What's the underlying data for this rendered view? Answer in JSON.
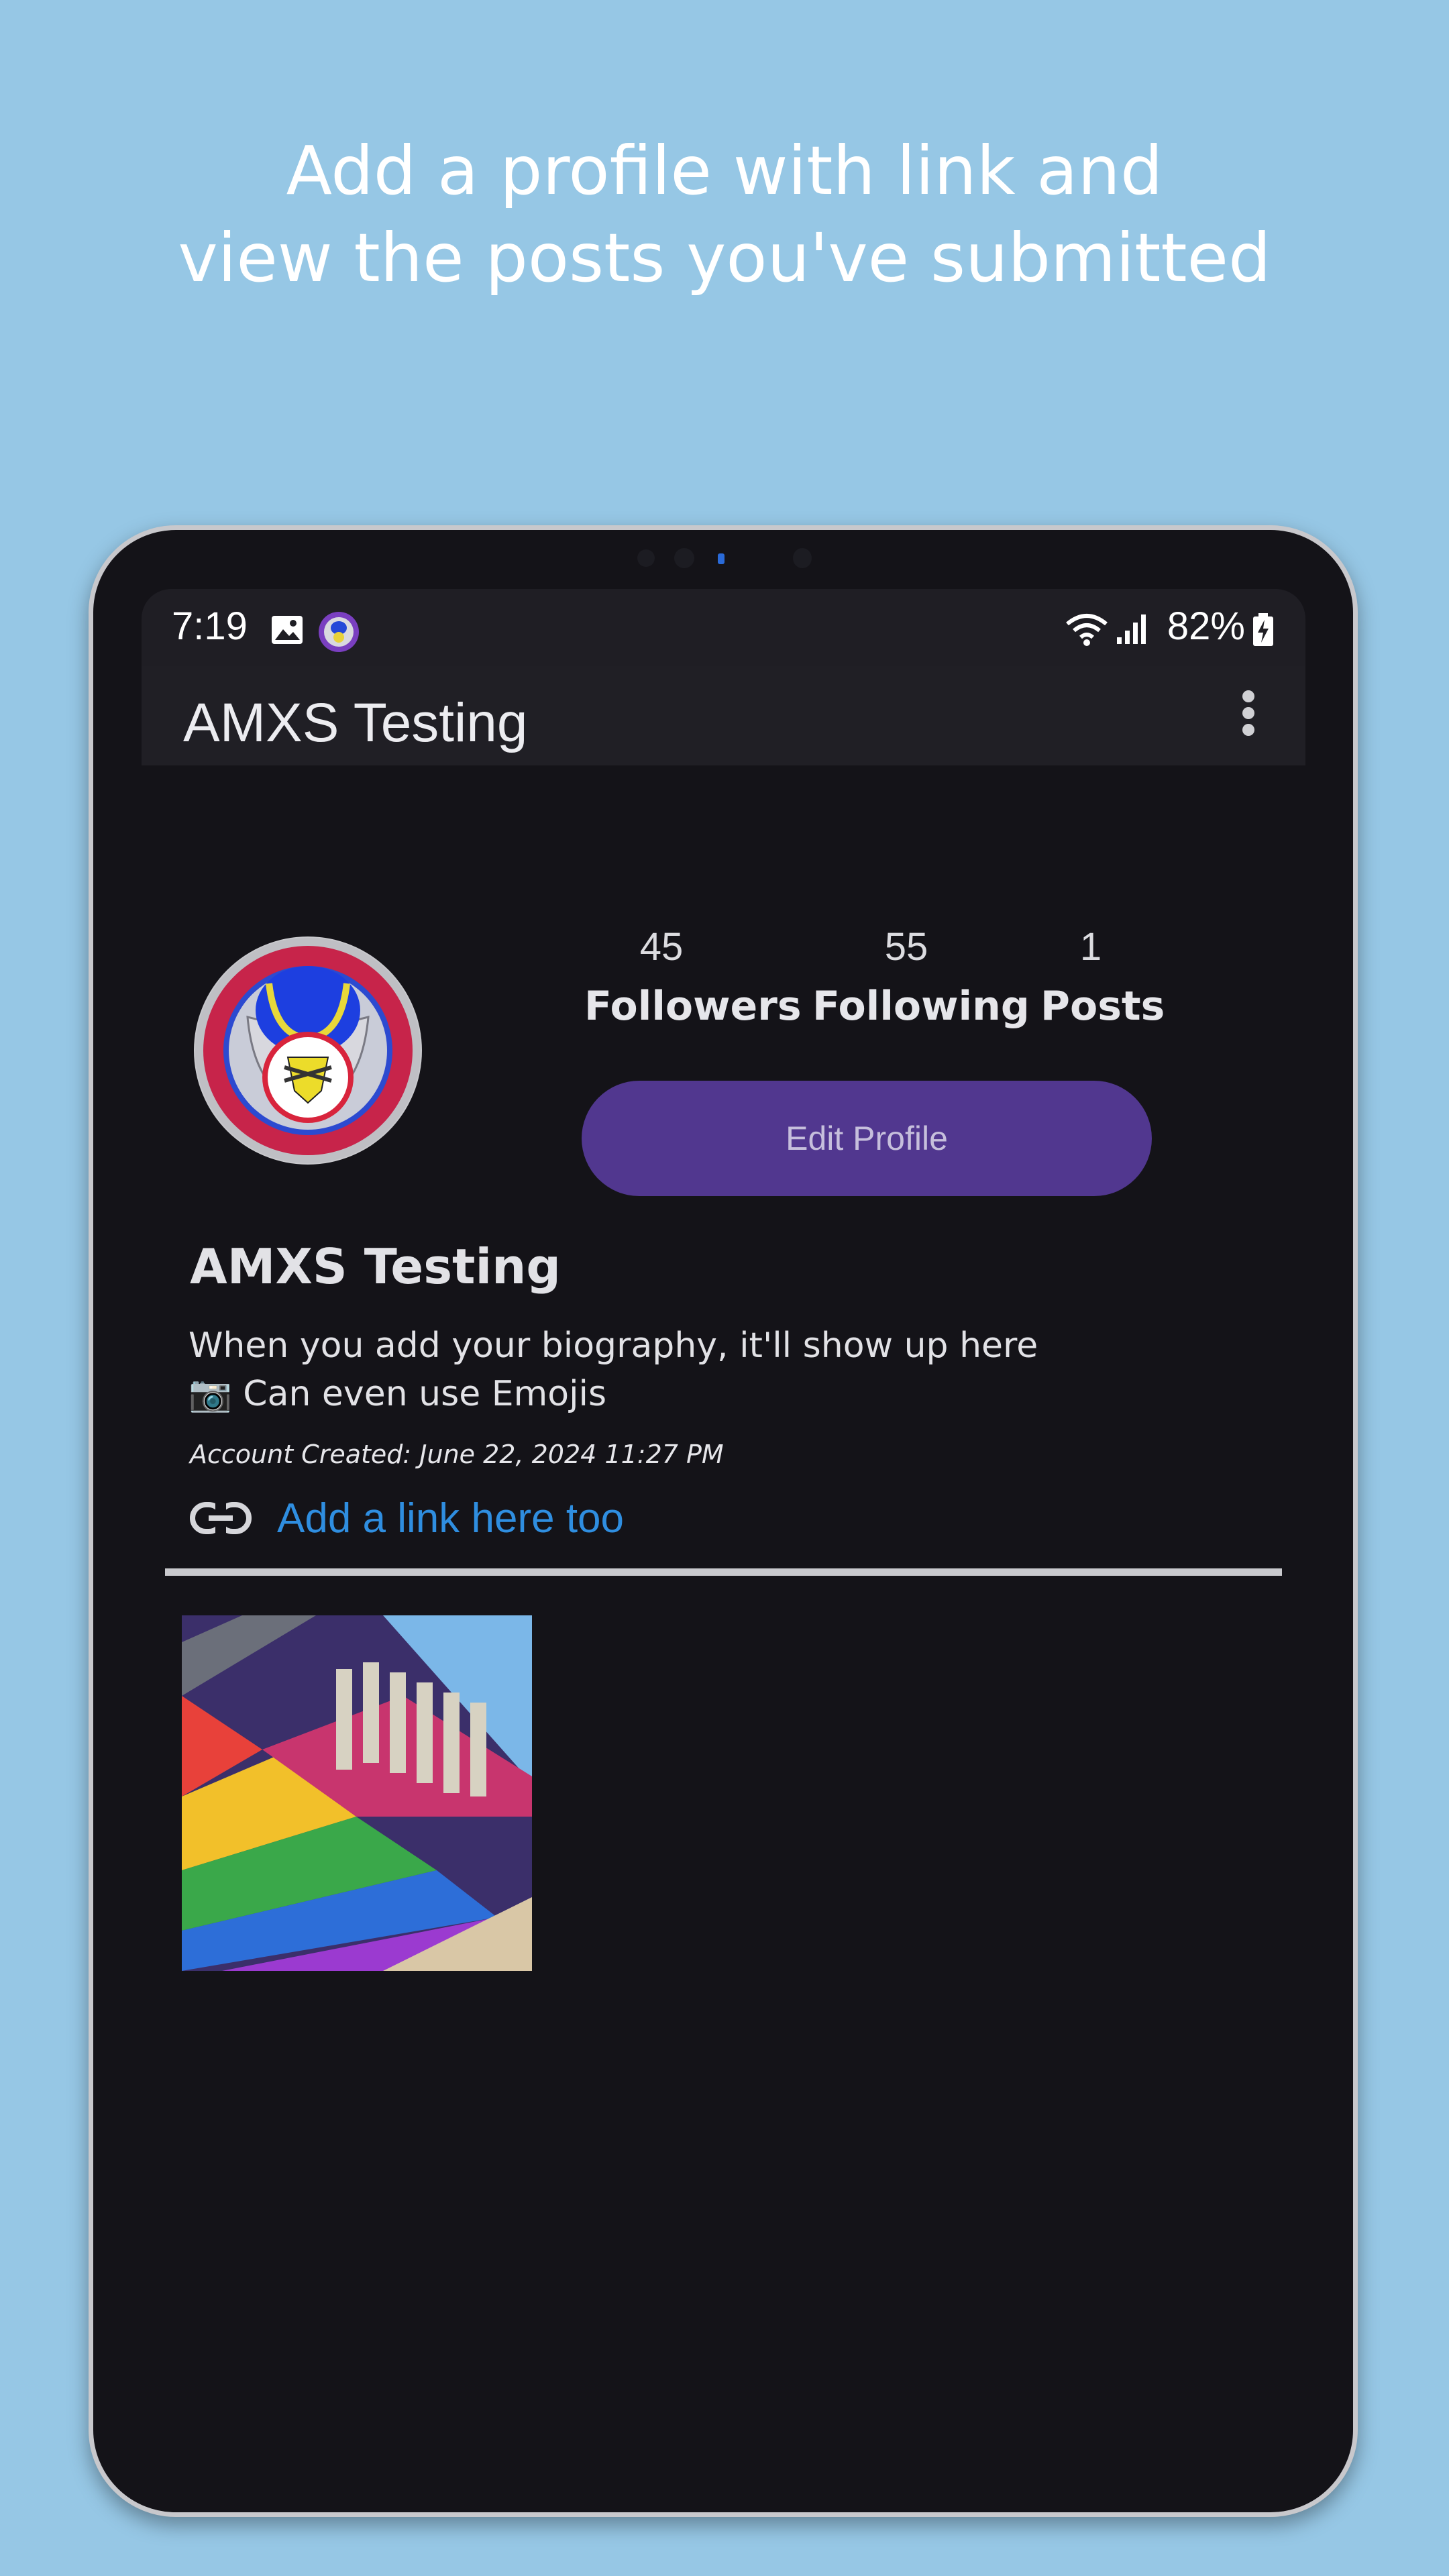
{
  "headline": {
    "line1": "Add a profile with link and",
    "line2": "view the posts you've submitted"
  },
  "status_bar": {
    "time": "7:19",
    "battery": "82%",
    "icons": [
      "image-icon",
      "app-notification-icon",
      "wifi-icon",
      "signal-icon",
      "battery-charging-icon"
    ]
  },
  "app_bar": {
    "title": "AMXS Testing",
    "menu_icon": "more-vert-icon"
  },
  "profile": {
    "name": "AMXS Testing",
    "stats": [
      {
        "value": "45",
        "label": "Followers"
      },
      {
        "value": "55",
        "label": "Following"
      },
      {
        "value": "1",
        "label": "Posts"
      }
    ],
    "edit_button": "Edit Profile",
    "bio_line1": "When you add your biography, it'll show up here",
    "bio_line2": "📷 Can even use Emojis",
    "account_created": "Account Created: June 22, 2024 11:27 PM",
    "link_text": "Add a link here too"
  },
  "posts": [
    {
      "alt": "Colorful mural post"
    }
  ],
  "colors": {
    "background": "#96c7e5",
    "screen": "#141318",
    "accent_button": "#51378f",
    "link": "#2f8ee0"
  }
}
